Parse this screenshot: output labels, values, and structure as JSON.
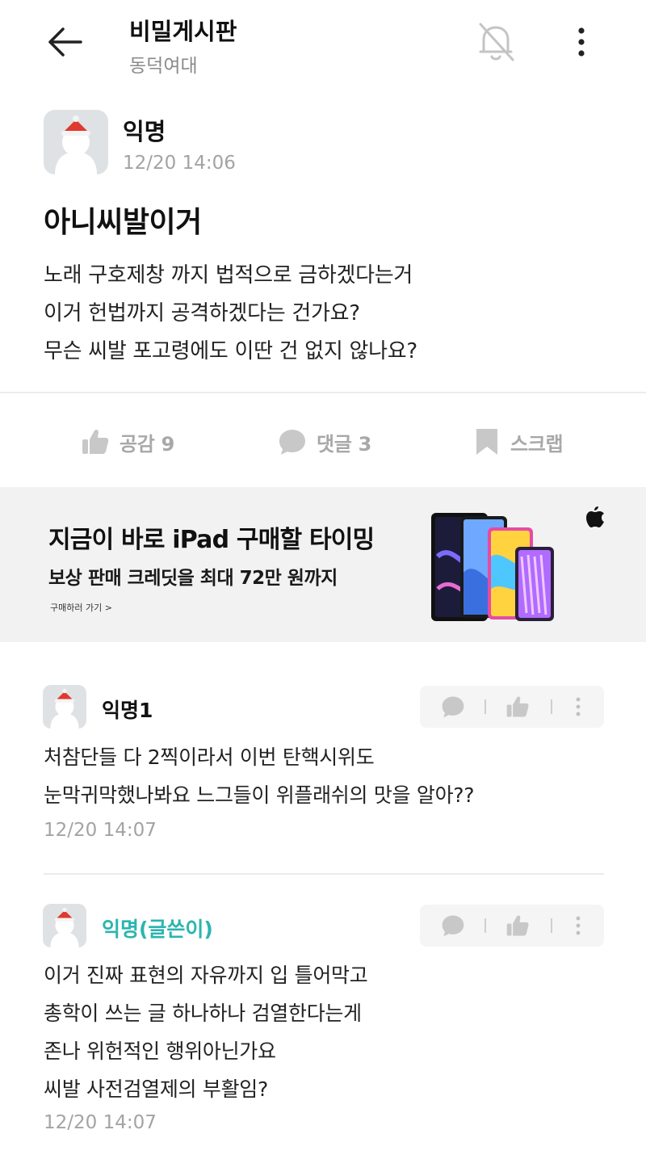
{
  "header": {
    "title": "비밀게시판",
    "subtitle": "동덕여대"
  },
  "post": {
    "author": "익명",
    "time": "12/20 14:06",
    "title": "아니씨발이거",
    "body": [
      "노래 구호제창 까지 법적으로 금하겠다는거",
      "이거 헌법까지 공격하겠다는 건가요?",
      "무슨 씨발 포고령에도 이딴 건 없지 않나요?"
    ]
  },
  "actions": {
    "like_label": "공감 9",
    "comment_label": "댓글 3",
    "scrap_label": "스크랩"
  },
  "ad": {
    "headline": "지금이 바로 iPad 구매할 타이밍",
    "subline": "보상 판매 크레딧을 최대 72만 원까지",
    "link": "구매하러 가기 >"
  },
  "comments": [
    {
      "author": "익명1",
      "lines": [
        "처참단들 다 2찍이라서 이번 탄핵시위도",
        "눈막귀막했나봐요 느그들이 위플래쉬의 맛을 알아??"
      ],
      "time": "12/20 14:07"
    },
    {
      "author": "익명(글쓴이)",
      "lines": [
        "이거 진짜 표현의 자유까지 입 틀어막고",
        "총학이 쓰는 글 하나하나 검열한다는게",
        "존나 위헌적인 행위아닌가요",
        "씨발 사전검열제의 부활임?"
      ],
      "time": "12/20 14:07"
    }
  ],
  "colors": {
    "accent_op": "#2bb5b0",
    "muted": "#a8a8a8",
    "ad_bg": "#f2f2f2"
  },
  "icons": [
    "back-arrow-icon",
    "bell-off-icon",
    "more-vertical-icon",
    "thumbs-up-icon",
    "speech-bubble-icon",
    "bookmark-icon",
    "apple-logo-icon"
  ]
}
